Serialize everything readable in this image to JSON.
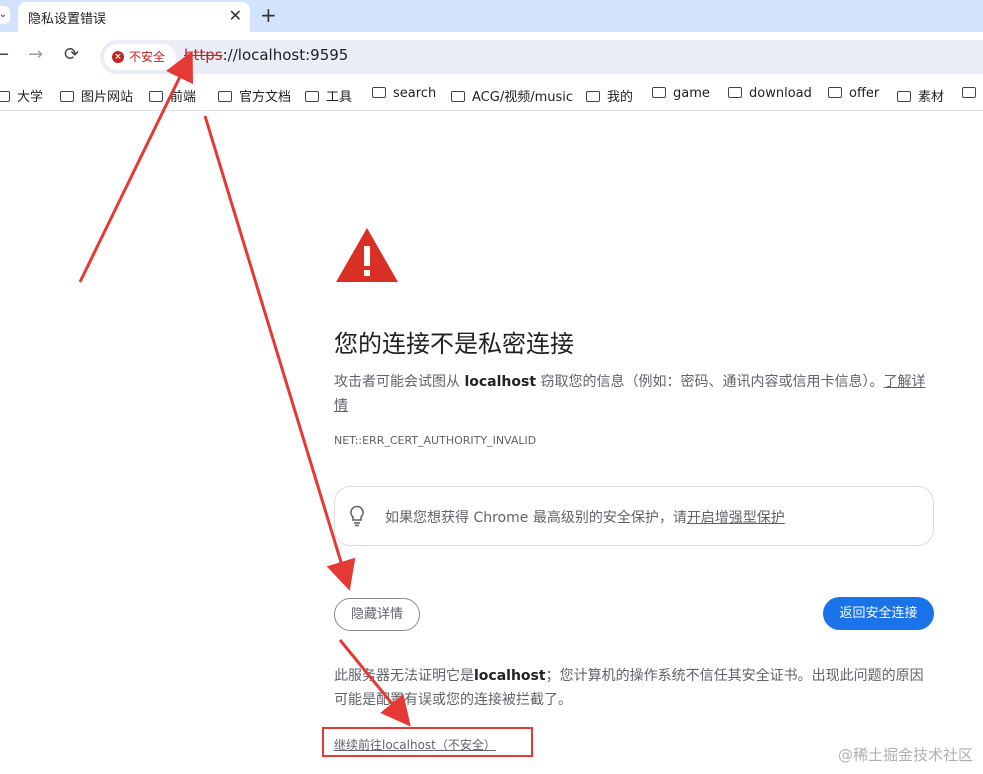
{
  "tab": {
    "title": "隐私设置错误",
    "close": "✕",
    "new_tab": "+"
  },
  "toolbar": {
    "back": "←",
    "forward": "→",
    "reload": "⟳",
    "security_chip": "不安全",
    "url_scheme": "https",
    "url_rest": "://localhost:9595"
  },
  "bookmarks": [
    "大学",
    "图片网站",
    "前端",
    "官方文档",
    "工具",
    "search",
    "ACG/视频/music",
    "我的",
    "game",
    "download",
    "offer",
    "素材"
  ],
  "page": {
    "heading": "您的连接不是私密连接",
    "desc_before": "攻击者可能会试图从 ",
    "desc_host": "localhost",
    "desc_after": " 窃取您的信息（例如：密码、通讯内容或信用卡信息）。",
    "learn_more": "了解详情",
    "error_code": "NET::ERR_CERT_AUTHORITY_INVALID",
    "promo_text": "如果您想获得 Chrome 最高级别的安全保护，请",
    "promo_link": "开启增强型保护",
    "hide_details_button": "隐藏详情",
    "back_button": "返回安全连接",
    "details_before": "此服务器无法证明它是",
    "details_host": "localhost",
    "details_after": "；您计算机的操作系统不信任其安全证书。出现此问题的原因可能是配置有误或您的连接被拦截了。",
    "proceed_link": "继续前往localhost（不安全）"
  },
  "watermark": "@稀土掘金技术社区",
  "colors": {
    "warning_red": "#d93025",
    "annotation_red": "#e53935",
    "primary_blue": "#1a73e8",
    "tab_strip": "#d3e3fd"
  },
  "icons": [
    "warning-triangle-icon",
    "lightbulb-icon",
    "folder-icon",
    "not-secure-icon"
  ]
}
